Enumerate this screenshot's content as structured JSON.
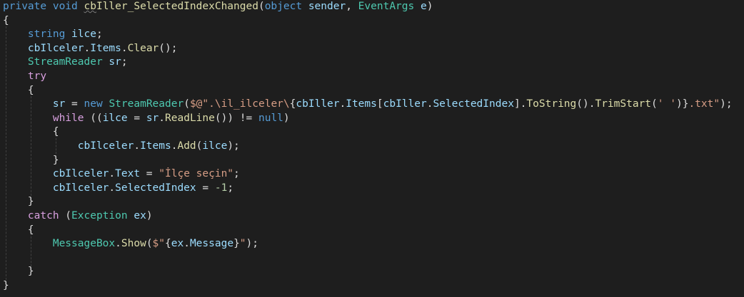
{
  "theme": {
    "background": "#1e1e1e",
    "keyword": "#569cd6",
    "control": "#d8a0df",
    "type": "#4ec9b0",
    "method": "#dcdcaa",
    "identifier": "#9cdcfe",
    "string": "#d69d85",
    "number": "#b5cea8",
    "default": "#dcdcdc"
  },
  "code": {
    "lines": [
      [
        {
          "t": "private",
          "c": "kw"
        },
        {
          "t": " ",
          "c": "punc"
        },
        {
          "t": "void",
          "c": "kw"
        },
        {
          "t": " ",
          "c": "punc"
        },
        {
          "t": "cb",
          "c": "method",
          "s": true
        },
        {
          "t": "Iller_SelectedIndexChanged",
          "c": "method"
        },
        {
          "t": "(",
          "c": "punc"
        },
        {
          "t": "object",
          "c": "kw"
        },
        {
          "t": " ",
          "c": "punc"
        },
        {
          "t": "sender",
          "c": "ident"
        },
        {
          "t": ", ",
          "c": "punc"
        },
        {
          "t": "EventArgs",
          "c": "type"
        },
        {
          "t": " ",
          "c": "punc"
        },
        {
          "t": "e",
          "c": "ident"
        },
        {
          "t": ")",
          "c": "punc"
        }
      ],
      [
        {
          "t": "{",
          "c": "punc"
        }
      ],
      [
        {
          "t": "    ",
          "c": "punc"
        },
        {
          "t": "string",
          "c": "kw"
        },
        {
          "t": " ",
          "c": "punc"
        },
        {
          "t": "ilce",
          "c": "ident"
        },
        {
          "t": ";",
          "c": "punc"
        }
      ],
      [
        {
          "t": "    ",
          "c": "punc"
        },
        {
          "t": "cbIlceler",
          "c": "ident"
        },
        {
          "t": ".",
          "c": "punc"
        },
        {
          "t": "Items",
          "c": "ident"
        },
        {
          "t": ".",
          "c": "punc"
        },
        {
          "t": "Clear",
          "c": "method"
        },
        {
          "t": "();",
          "c": "punc"
        }
      ],
      [
        {
          "t": "    ",
          "c": "punc"
        },
        {
          "t": "StreamReader",
          "c": "type"
        },
        {
          "t": " ",
          "c": "punc"
        },
        {
          "t": "sr",
          "c": "ident"
        },
        {
          "t": ";",
          "c": "punc"
        }
      ],
      [
        {
          "t": "    ",
          "c": "punc"
        },
        {
          "t": "try",
          "c": "ctl"
        }
      ],
      [
        {
          "t": "    ",
          "c": "punc"
        },
        {
          "t": "{",
          "c": "punc"
        }
      ],
      [
        {
          "t": "        ",
          "c": "punc"
        },
        {
          "t": "sr",
          "c": "ident"
        },
        {
          "t": " = ",
          "c": "punc"
        },
        {
          "t": "new",
          "c": "kw"
        },
        {
          "t": " ",
          "c": "punc"
        },
        {
          "t": "StreamReader",
          "c": "type"
        },
        {
          "t": "(",
          "c": "punc"
        },
        {
          "t": "$@\".\\il_ilceler\\",
          "c": "str"
        },
        {
          "t": "{",
          "c": "punc"
        },
        {
          "t": "cbIller",
          "c": "ident"
        },
        {
          "t": ".",
          "c": "punc"
        },
        {
          "t": "Items",
          "c": "ident"
        },
        {
          "t": "[",
          "c": "punc"
        },
        {
          "t": "cbIller",
          "c": "ident"
        },
        {
          "t": ".",
          "c": "punc"
        },
        {
          "t": "SelectedIndex",
          "c": "ident"
        },
        {
          "t": "].",
          "c": "punc"
        },
        {
          "t": "ToString",
          "c": "method"
        },
        {
          "t": "().",
          "c": "punc"
        },
        {
          "t": "TrimStart",
          "c": "method"
        },
        {
          "t": "(",
          "c": "punc"
        },
        {
          "t": "' '",
          "c": "str"
        },
        {
          "t": ")}",
          "c": "punc"
        },
        {
          "t": ".txt\"",
          "c": "str"
        },
        {
          "t": ");",
          "c": "punc"
        }
      ],
      [
        {
          "t": "        ",
          "c": "punc"
        },
        {
          "t": "while",
          "c": "ctl"
        },
        {
          "t": " ((",
          "c": "punc"
        },
        {
          "t": "ilce",
          "c": "ident"
        },
        {
          "t": " = ",
          "c": "punc"
        },
        {
          "t": "sr",
          "c": "ident"
        },
        {
          "t": ".",
          "c": "punc"
        },
        {
          "t": "ReadLine",
          "c": "method"
        },
        {
          "t": "()) != ",
          "c": "punc"
        },
        {
          "t": "null",
          "c": "kw"
        },
        {
          "t": ")",
          "c": "punc"
        }
      ],
      [
        {
          "t": "        ",
          "c": "punc"
        },
        {
          "t": "{",
          "c": "punc"
        }
      ],
      [
        {
          "t": "            ",
          "c": "punc"
        },
        {
          "t": "cbIlceler",
          "c": "ident"
        },
        {
          "t": ".",
          "c": "punc"
        },
        {
          "t": "Items",
          "c": "ident"
        },
        {
          "t": ".",
          "c": "punc"
        },
        {
          "t": "Add",
          "c": "method"
        },
        {
          "t": "(",
          "c": "punc"
        },
        {
          "t": "ilce",
          "c": "ident"
        },
        {
          "t": ");",
          "c": "punc"
        }
      ],
      [
        {
          "t": "        ",
          "c": "punc"
        },
        {
          "t": "}",
          "c": "punc"
        }
      ],
      [
        {
          "t": "        ",
          "c": "punc"
        },
        {
          "t": "cbIlceler",
          "c": "ident"
        },
        {
          "t": ".",
          "c": "punc"
        },
        {
          "t": "Text",
          "c": "ident"
        },
        {
          "t": " = ",
          "c": "punc"
        },
        {
          "t": "\"İlçe seçin\"",
          "c": "str"
        },
        {
          "t": ";",
          "c": "punc"
        }
      ],
      [
        {
          "t": "        ",
          "c": "punc"
        },
        {
          "t": "cbIlceler",
          "c": "ident"
        },
        {
          "t": ".",
          "c": "punc"
        },
        {
          "t": "SelectedIndex",
          "c": "ident"
        },
        {
          "t": " = ",
          "c": "punc"
        },
        {
          "t": "-1",
          "c": "num"
        },
        {
          "t": ";",
          "c": "punc"
        }
      ],
      [
        {
          "t": "    ",
          "c": "punc"
        },
        {
          "t": "}",
          "c": "punc"
        }
      ],
      [
        {
          "t": "    ",
          "c": "punc"
        },
        {
          "t": "catch",
          "c": "ctl"
        },
        {
          "t": " (",
          "c": "punc"
        },
        {
          "t": "Exception",
          "c": "type"
        },
        {
          "t": " ",
          "c": "punc"
        },
        {
          "t": "ex",
          "c": "ident"
        },
        {
          "t": ")",
          "c": "punc"
        }
      ],
      [
        {
          "t": "    ",
          "c": "punc"
        },
        {
          "t": "{",
          "c": "punc"
        }
      ],
      [
        {
          "t": "        ",
          "c": "punc"
        },
        {
          "t": "MessageBox",
          "c": "type"
        },
        {
          "t": ".",
          "c": "punc"
        },
        {
          "t": "Show",
          "c": "method"
        },
        {
          "t": "(",
          "c": "punc"
        },
        {
          "t": "$\"",
          "c": "str"
        },
        {
          "t": "{",
          "c": "punc"
        },
        {
          "t": "ex",
          "c": "ident"
        },
        {
          "t": ".",
          "c": "punc"
        },
        {
          "t": "Message",
          "c": "ident"
        },
        {
          "t": "}",
          "c": "punc"
        },
        {
          "t": "\"",
          "c": "str"
        },
        {
          "t": ");",
          "c": "punc"
        }
      ],
      [
        {
          "t": "",
          "c": "punc"
        }
      ],
      [
        {
          "t": "    ",
          "c": "punc"
        },
        {
          "t": "}",
          "c": "punc"
        }
      ],
      [
        {
          "t": "}",
          "c": "punc"
        }
      ]
    ]
  }
}
